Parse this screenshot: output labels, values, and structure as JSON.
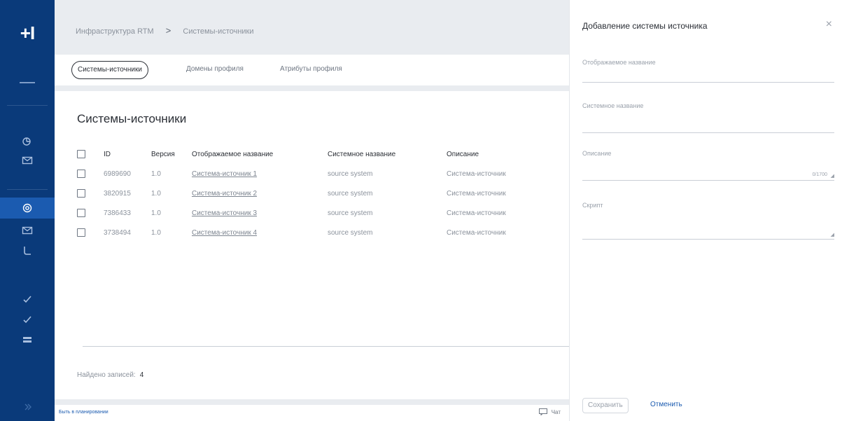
{
  "rail": {
    "logo": "+I"
  },
  "breadcrumb": {
    "root": "Инфраструктура RTM",
    "separator": ">",
    "current": "Системы-источники"
  },
  "tabs": [
    {
      "label": "Системы-источники",
      "selected": true
    },
    {
      "label": "Домены профиля",
      "selected": false
    },
    {
      "label": "Атрибуты профиля",
      "selected": false
    }
  ],
  "page": {
    "title": "Системы-источники"
  },
  "table": {
    "headers": [
      "ID",
      "Версия",
      "Отображаемое название",
      "Системное название",
      "Описание"
    ],
    "rows": [
      [
        "6989690",
        "1.0",
        "Система-источник 1",
        "source system",
        "Система-источник"
      ],
      [
        "3820915",
        "1.0",
        "Система-источник 2",
        "source system",
        "Система-источник"
      ],
      [
        "7386433",
        "1.0",
        "Система-источник 3",
        "source system",
        "Система-источник"
      ],
      [
        "3738494",
        "1.0",
        "Система-источник 4",
        "source system",
        "Система-источник"
      ]
    ]
  },
  "found": {
    "label": "Найдено записей:",
    "count": "4"
  },
  "footer": {
    "link": "Быть в планировании",
    "chat": "Чат"
  },
  "drawer": {
    "title": "Добавление системы источника",
    "fields": {
      "display_name": "Отображаемое название",
      "system_name": "Системное название",
      "description": "Описание",
      "description_counter": "0/1700",
      "script": "Скрипт"
    },
    "save": "Сохранить",
    "cancel": "Отменить"
  },
  "colors": {
    "rail": "#0a3a7a",
    "accent": "#1b5bb0"
  }
}
